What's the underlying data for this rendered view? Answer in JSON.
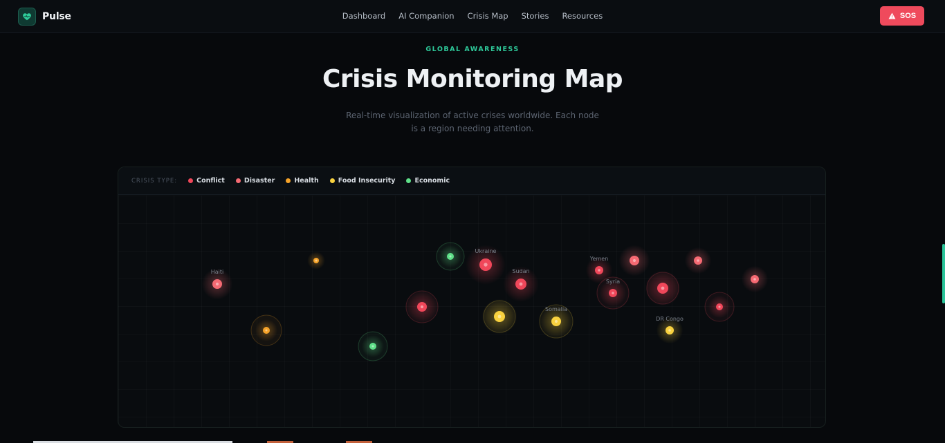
{
  "brand": {
    "name": "Pulse",
    "icon": "heart-pulse-icon"
  },
  "nav": {
    "links": [
      "Dashboard",
      "AI Companion",
      "Crisis Map",
      "Stories",
      "Resources"
    ],
    "sos_label": "SOS"
  },
  "hero": {
    "eyebrow": "GLOBAL AWARENESS",
    "title": "Crisis Monitoring Map",
    "subtitle_line1": "Real-time visualization of active crises worldwide. Each node",
    "subtitle_line2": "is a region needing attention."
  },
  "legend": {
    "title": "CRISIS TYPE:",
    "items": [
      {
        "label": "Conflict",
        "color": "#f0475a"
      },
      {
        "label": "Disaster",
        "color": "#f56a73"
      },
      {
        "label": "Health",
        "color": "#f6a329"
      },
      {
        "label": "Food Insecurity",
        "color": "#f8d13f"
      },
      {
        "label": "Economic",
        "color": "#5fe089"
      }
    ]
  },
  "nodes": [
    {
      "label": "Haiti",
      "type": "Disaster"
    },
    {
      "label": "",
      "type": "Health"
    },
    {
      "label": "",
      "type": "Health"
    },
    {
      "label": "",
      "type": "Economic"
    },
    {
      "label": "",
      "type": "Economic"
    },
    {
      "label": "",
      "type": "Conflict"
    },
    {
      "label": "Ukraine",
      "type": "Conflict"
    },
    {
      "label": "",
      "type": "Food Insecurity"
    },
    {
      "label": "Sudan",
      "type": "Conflict"
    },
    {
      "label": "Somalia",
      "type": "Food Insecurity"
    },
    {
      "label": "Yemen",
      "type": "Conflict"
    },
    {
      "label": "Syria",
      "type": "Conflict"
    },
    {
      "label": "",
      "type": "Disaster"
    },
    {
      "label": "",
      "type": "Conflict"
    },
    {
      "label": "DR Congo",
      "type": "Food Insecurity"
    },
    {
      "label": "",
      "type": "Disaster"
    },
    {
      "label": "",
      "type": "Conflict"
    },
    {
      "label": "",
      "type": "Disaster"
    }
  ]
}
